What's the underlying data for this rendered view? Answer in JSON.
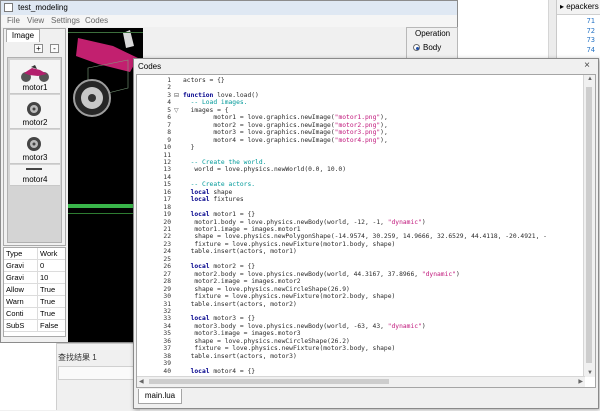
{
  "ide_background": {
    "right_tab_label": "epackers",
    "right_line_numbers": [
      "71",
      "72",
      "73",
      "74"
    ],
    "bottom_panel_label": "查找结果 1"
  },
  "main_window": {
    "title": "test_modeling",
    "menu": [
      "File",
      "View",
      "Settings",
      "Codes"
    ],
    "image_tab": "Image",
    "add_btn": "+",
    "remove_btn": "-",
    "images": [
      {
        "name": "motor1",
        "icon": "motorcycle-thumbnail-icon"
      },
      {
        "name": "motor2",
        "icon": "wheel-thumbnail-icon"
      },
      {
        "name": "motor3",
        "icon": "wheel-thumbnail-icon"
      },
      {
        "name": "motor4",
        "icon": "bar-thumbnail-icon"
      }
    ],
    "properties": [
      {
        "key": "Type",
        "value": "Work"
      },
      {
        "key": "Gravi",
        "value": "0"
      },
      {
        "key": "Gravi",
        "value": "10"
      },
      {
        "key": "Allow",
        "value": "True"
      },
      {
        "key": "Warn",
        "value": "True"
      },
      {
        "key": "Conti",
        "value": "True"
      },
      {
        "key": "SubS",
        "value": "False"
      }
    ],
    "operation": {
      "title": "Operation",
      "selected": "Body"
    }
  },
  "codes_window": {
    "title": "Codes",
    "close": "×",
    "file_tab": "main.lua",
    "lines": [
      [
        [
          "actors = {}",
          "nm"
        ]
      ],
      [
        [
          "",
          "nm"
        ]
      ],
      [
        [
          "function",
          "kw"
        ],
        [
          " love.load()",
          "nm"
        ]
      ],
      [
        [
          "  -- Load images.",
          "cm"
        ]
      ],
      [
        [
          "  images = {",
          "nm"
        ]
      ],
      [
        [
          "        motor1 = love.graphics.newImage(",
          "nm"
        ],
        [
          "\"motor1.png\"",
          "st"
        ],
        [
          "),",
          "nm"
        ]
      ],
      [
        [
          "        motor2 = love.graphics.newImage(",
          "nm"
        ],
        [
          "\"motor2.png\"",
          "st"
        ],
        [
          "),",
          "nm"
        ]
      ],
      [
        [
          "        motor3 = love.graphics.newImage(",
          "nm"
        ],
        [
          "\"motor3.png\"",
          "st"
        ],
        [
          "),",
          "nm"
        ]
      ],
      [
        [
          "        motor4 = love.graphics.newImage(",
          "nm"
        ],
        [
          "\"motor4.png\"",
          "st"
        ],
        [
          "),",
          "nm"
        ]
      ],
      [
        [
          "  }",
          "nm"
        ]
      ],
      [
        [
          "",
          "nm"
        ]
      ],
      [
        [
          "  -- Create the world.",
          "cm"
        ]
      ],
      [
        [
          "   world = love.physics.newWorld(0.0, 10.0)",
          "nm"
        ]
      ],
      [
        [
          "",
          "nm"
        ]
      ],
      [
        [
          "  -- Create actors.",
          "cm"
        ]
      ],
      [
        [
          "  local",
          "kw"
        ],
        [
          " shape",
          "nm"
        ]
      ],
      [
        [
          "  local",
          "kw"
        ],
        [
          " fixtures",
          "nm"
        ]
      ],
      [
        [
          "",
          "nm"
        ]
      ],
      [
        [
          "  local",
          "kw"
        ],
        [
          " motor1 = {}",
          "nm"
        ]
      ],
      [
        [
          "   motor1.body = love.physics.newBody(world, -12, -1, ",
          "nm"
        ],
        [
          "\"dynamic\"",
          "st"
        ],
        [
          ")",
          "nm"
        ]
      ],
      [
        [
          "   motor1.image = images.motor1",
          "nm"
        ]
      ],
      [
        [
          "   shape = love.physics.newPolygonShape(-14.9574, 30.259, 14.9666, 32.6529, 44.4118, -20.4921, -",
          "nm"
        ]
      ],
      [
        [
          "   fixture = love.physics.newFixture(motor1.body, shape)",
          "nm"
        ]
      ],
      [
        [
          "  table.insert(actors, motor1)",
          "nm"
        ]
      ],
      [
        [
          "",
          "nm"
        ]
      ],
      [
        [
          "  local",
          "kw"
        ],
        [
          " motor2 = {}",
          "nm"
        ]
      ],
      [
        [
          "   motor2.body = love.physics.newBody(world, 44.3167, 37.8966, ",
          "nm"
        ],
        [
          "\"dynamic\"",
          "st"
        ],
        [
          ")",
          "nm"
        ]
      ],
      [
        [
          "   motor2.image = images.motor2",
          "nm"
        ]
      ],
      [
        [
          "   shape = love.physics.newCircleShape(26.9)",
          "nm"
        ]
      ],
      [
        [
          "   fixture = love.physics.newFixture(motor2.body, shape)",
          "nm"
        ]
      ],
      [
        [
          "  table.insert(actors, motor2)",
          "nm"
        ]
      ],
      [
        [
          "",
          "nm"
        ]
      ],
      [
        [
          "  local",
          "kw"
        ],
        [
          " motor3 = {}",
          "nm"
        ]
      ],
      [
        [
          "   motor3.body = love.physics.newBody(world, -63, 43, ",
          "nm"
        ],
        [
          "\"dynamic\"",
          "st"
        ],
        [
          ")",
          "nm"
        ]
      ],
      [
        [
          "   motor3.image = images.motor3",
          "nm"
        ]
      ],
      [
        [
          "   shape = love.physics.newCircleShape(26.2)",
          "nm"
        ]
      ],
      [
        [
          "   fixture = love.physics.newFixture(motor3.body, shape)",
          "nm"
        ]
      ],
      [
        [
          "  table.insert(actors, motor3)",
          "nm"
        ]
      ],
      [
        [
          "",
          "nm"
        ]
      ],
      [
        [
          "  local",
          "kw"
        ],
        [
          " motor4 = {}",
          "nm"
        ]
      ]
    ]
  },
  "colors": {
    "keyword": "#00008b",
    "comment": "#009a9a",
    "string": "#c0157a",
    "scene_background": "#000000"
  }
}
